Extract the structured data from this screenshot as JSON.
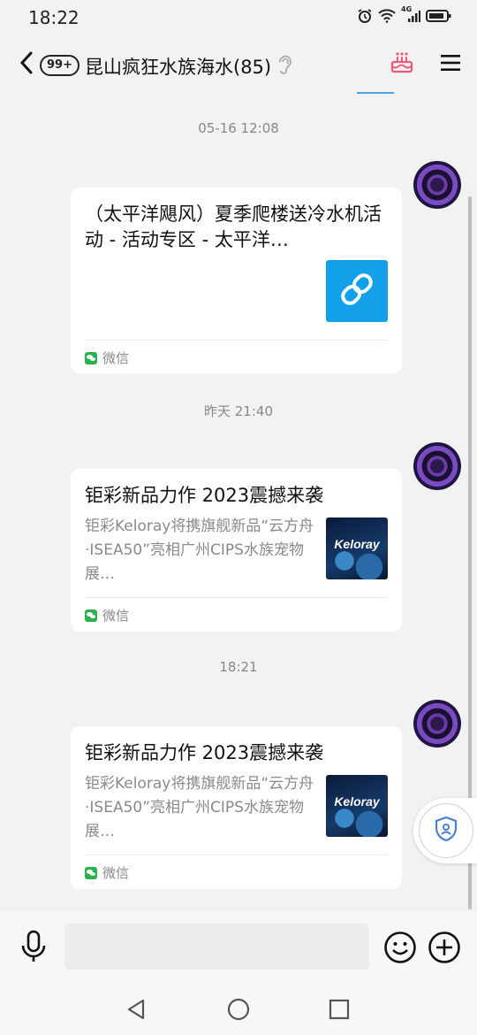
{
  "status": {
    "time": "18:22",
    "network": "4G"
  },
  "header": {
    "unread": "99+",
    "title": "昆山疯狂水族海水(85)"
  },
  "messages": [
    {
      "time": "05-16 12:08",
      "card": {
        "title": "（太平洋飓风）夏季爬楼送冷水机活动 - 活动专区 - 太平洋…",
        "description": "",
        "thumb": "link-icon",
        "source": "微信"
      }
    },
    {
      "time": "昨天 21:40",
      "card": {
        "title": "钜彩新品力作 2023震撼来袭",
        "description": "钜彩Keloray将携旗舰新品“云方舟·ISEA50”亮相广州CIPS水族宠物展…",
        "thumb_text": "Keloray",
        "source": "微信"
      }
    },
    {
      "time": "18:21",
      "card": {
        "title": "钜彩新品力作 2023震撼来袭",
        "description": "钜彩Keloray将携旗舰新品“云方舟·ISEA50”亮相广州CIPS水族宠物展…",
        "thumb_text": "Keloray",
        "source": "微信"
      }
    }
  ],
  "input": {
    "value": "",
    "placeholder": ""
  },
  "colors": {
    "accent": "#12a1e8",
    "wechat": "#2bb24c",
    "cake": "#f05a7a"
  }
}
